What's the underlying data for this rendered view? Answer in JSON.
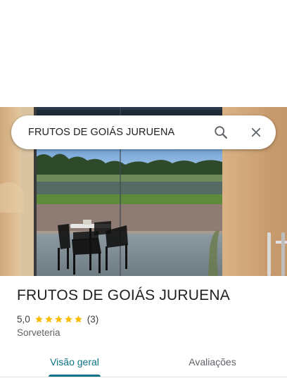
{
  "search": {
    "query": "FRUTOS DE GOIÁS JURUENA",
    "search_icon": "search-icon",
    "close_icon": "close-icon"
  },
  "hero": {
    "image": "storefront-photo"
  },
  "place": {
    "name": "FRUTOS DE GOIÁS JURUENA",
    "rating": "5,0",
    "stars": 5,
    "review_count": "(3)",
    "category": "Sorveteria"
  },
  "tabs": [
    {
      "label": "Visão geral",
      "active": true
    },
    {
      "label": "Avaliações",
      "active": false
    }
  ],
  "colors": {
    "accent": "#0b7185",
    "star": "#fbbc04",
    "text_primary": "#202124",
    "text_secondary": "#5f6368"
  }
}
